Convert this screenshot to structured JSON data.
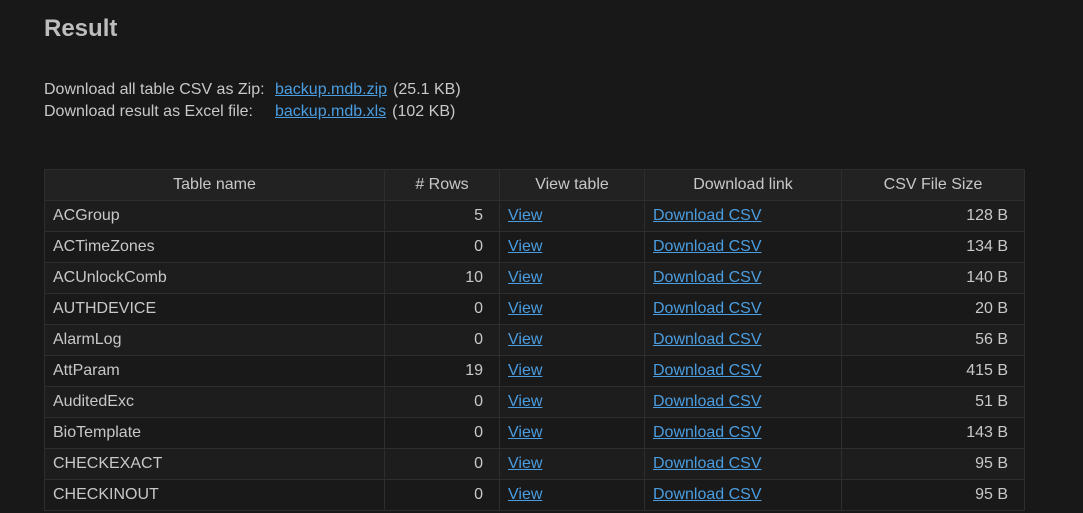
{
  "page": {
    "title": "Result"
  },
  "downloads": [
    {
      "label": "Download all table CSV as Zip:",
      "link": "backup.mdb.zip",
      "size": "(25.1 KB)"
    },
    {
      "label": "Download result as Excel file:",
      "link": "backup.mdb.xls",
      "size": "(102 KB)"
    }
  ],
  "table": {
    "headers": [
      "Table name",
      "# Rows",
      "View table",
      "Download link",
      "CSV File Size"
    ],
    "rows": [
      {
        "name": "ACGroup",
        "rows": "5",
        "view": "View",
        "download": "Download CSV",
        "size": "128 B"
      },
      {
        "name": "ACTimeZones",
        "rows": "0",
        "view": "View",
        "download": "Download CSV",
        "size": "134 B"
      },
      {
        "name": "ACUnlockComb",
        "rows": "10",
        "view": "View",
        "download": "Download CSV",
        "size": "140 B"
      },
      {
        "name": "AUTHDEVICE",
        "rows": "0",
        "view": "View",
        "download": "Download CSV",
        "size": "20 B"
      },
      {
        "name": "AlarmLog",
        "rows": "0",
        "view": "View",
        "download": "Download CSV",
        "size": "56 B"
      },
      {
        "name": "AttParam",
        "rows": "19",
        "view": "View",
        "download": "Download CSV",
        "size": "415 B"
      },
      {
        "name": "AuditedExc",
        "rows": "0",
        "view": "View",
        "download": "Download CSV",
        "size": "51 B"
      },
      {
        "name": "BioTemplate",
        "rows": "0",
        "view": "View",
        "download": "Download CSV",
        "size": "143 B"
      },
      {
        "name": "CHECKEXACT",
        "rows": "0",
        "view": "View",
        "download": "Download CSV",
        "size": "95 B"
      },
      {
        "name": "CHECKINOUT",
        "rows": "0",
        "view": "View",
        "download": "Download CSV",
        "size": "95 B"
      }
    ]
  }
}
